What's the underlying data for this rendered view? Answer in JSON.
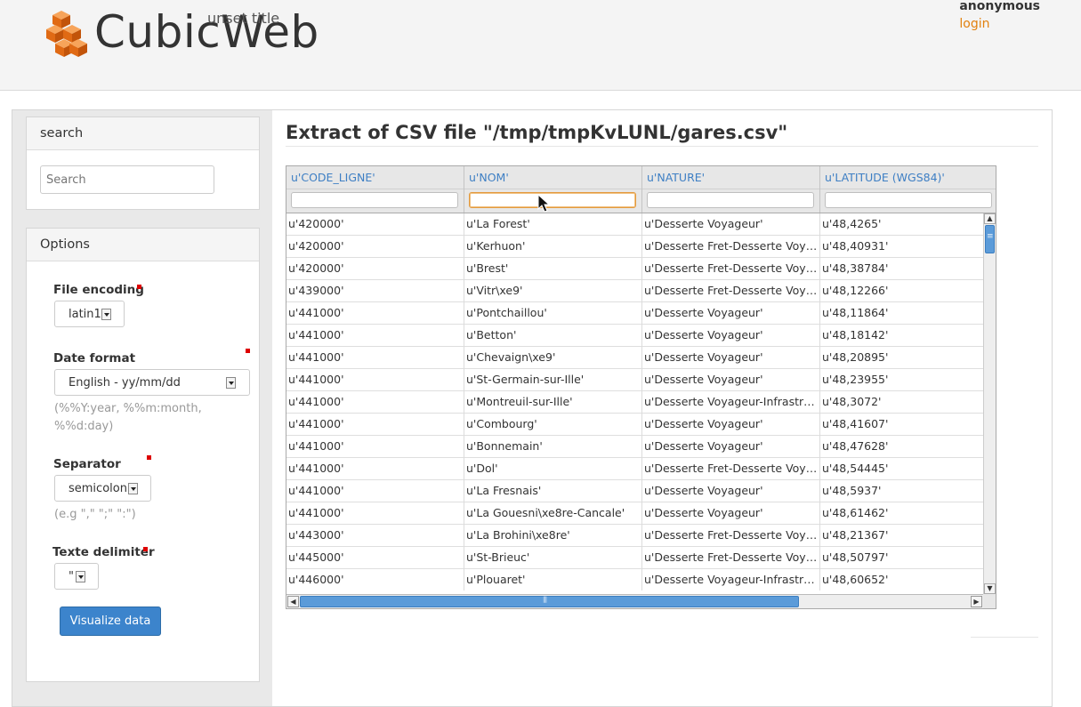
{
  "header": {
    "logo_text": "CubicWeb",
    "site_title": "unset title",
    "user": "anonymous",
    "login_label": "login",
    "accent_color": "#e2810f"
  },
  "search_box": {
    "title": "search",
    "placeholder": "Search"
  },
  "options_box": {
    "title": "Options",
    "file_encoding": {
      "label": "File encoding",
      "value": "latin1"
    },
    "date_format": {
      "label": "Date format",
      "value": "English - yy/mm/dd",
      "hint": "(%%Y:year, %%m:month, %%d:day)"
    },
    "separator": {
      "label": "Separator",
      "value": "semicolon",
      "hint": "(e.g \",\" \";\" \":\")"
    },
    "text_delimiter": {
      "label": "Texte delimiter",
      "value": "\""
    },
    "visualize_button": "Visualize data",
    "button_color": "#3c84cc"
  },
  "main": {
    "title": "Extract of CSV file \"/tmp/tmpKvLUNL/gares.csv\""
  },
  "grid": {
    "columns": [
      "u'CODE_LIGNE'",
      "u'NOM'",
      "u'NATURE'",
      "u'LATITUDE (WGS84)'"
    ],
    "rows": [
      [
        "u'420000'",
        "u'La Forest'",
        "u'Desserte Voyageur'",
        "u'48,4265'"
      ],
      [
        "u'420000'",
        "u'Kerhuon'",
        "u'Desserte Fret-Desserte Voyageur'",
        "u'48,40931'"
      ],
      [
        "u'420000'",
        "u'Brest'",
        "u'Desserte Fret-Desserte Voyageur'",
        "u'48,38784'"
      ],
      [
        "u'439000'",
        "u'Vitr\\xe9'",
        "u'Desserte Fret-Desserte Voyageur'",
        "u'48,12266'"
      ],
      [
        "u'441000'",
        "u'Pontchaillou'",
        "u'Desserte Voyageur'",
        "u'48,11864'"
      ],
      [
        "u'441000'",
        "u'Betton'",
        "u'Desserte Voyageur'",
        "u'48,18142'"
      ],
      [
        "u'441000'",
        "u'Chevaign\\xe9'",
        "u'Desserte Voyageur'",
        "u'48,20895'"
      ],
      [
        "u'441000'",
        "u'St-Germain-sur-Ille'",
        "u'Desserte Voyageur'",
        "u'48,23955'"
      ],
      [
        "u'441000'",
        "u'Montreuil-sur-Ille'",
        "u'Desserte Voyageur-Infrastructure'",
        "u'48,3072'"
      ],
      [
        "u'441000'",
        "u'Combourg'",
        "u'Desserte Voyageur'",
        "u'48,41607'"
      ],
      [
        "u'441000'",
        "u'Bonnemain'",
        "u'Desserte Voyageur'",
        "u'48,47628'"
      ],
      [
        "u'441000'",
        "u'Dol'",
        "u'Desserte Fret-Desserte Voyageur'",
        "u'48,54445'"
      ],
      [
        "u'441000'",
        "u'La Fresnais'",
        "u'Desserte Voyageur'",
        "u'48,5937'"
      ],
      [
        "u'441000'",
        "u'La Gouesni\\xe8re-Cancale'",
        "u'Desserte Voyageur'",
        "u'48,61462'"
      ],
      [
        "u'443000'",
        "u'La Brohini\\xe8re'",
        "u'Desserte Fret-Desserte Voyageur'",
        "u'48,21367'"
      ],
      [
        "u'445000'",
        "u'St-Brieuc'",
        "u'Desserte Fret-Desserte Voyageur'",
        "u'48,50797'"
      ],
      [
        "u'446000'",
        "u'Plouaret'",
        "u'Desserte Voyageur-Infrastructure'",
        "u'48,60652'"
      ],
      [
        "",
        "",
        "",
        ""
      ]
    ],
    "header_text_color": "#3e7fc4"
  }
}
